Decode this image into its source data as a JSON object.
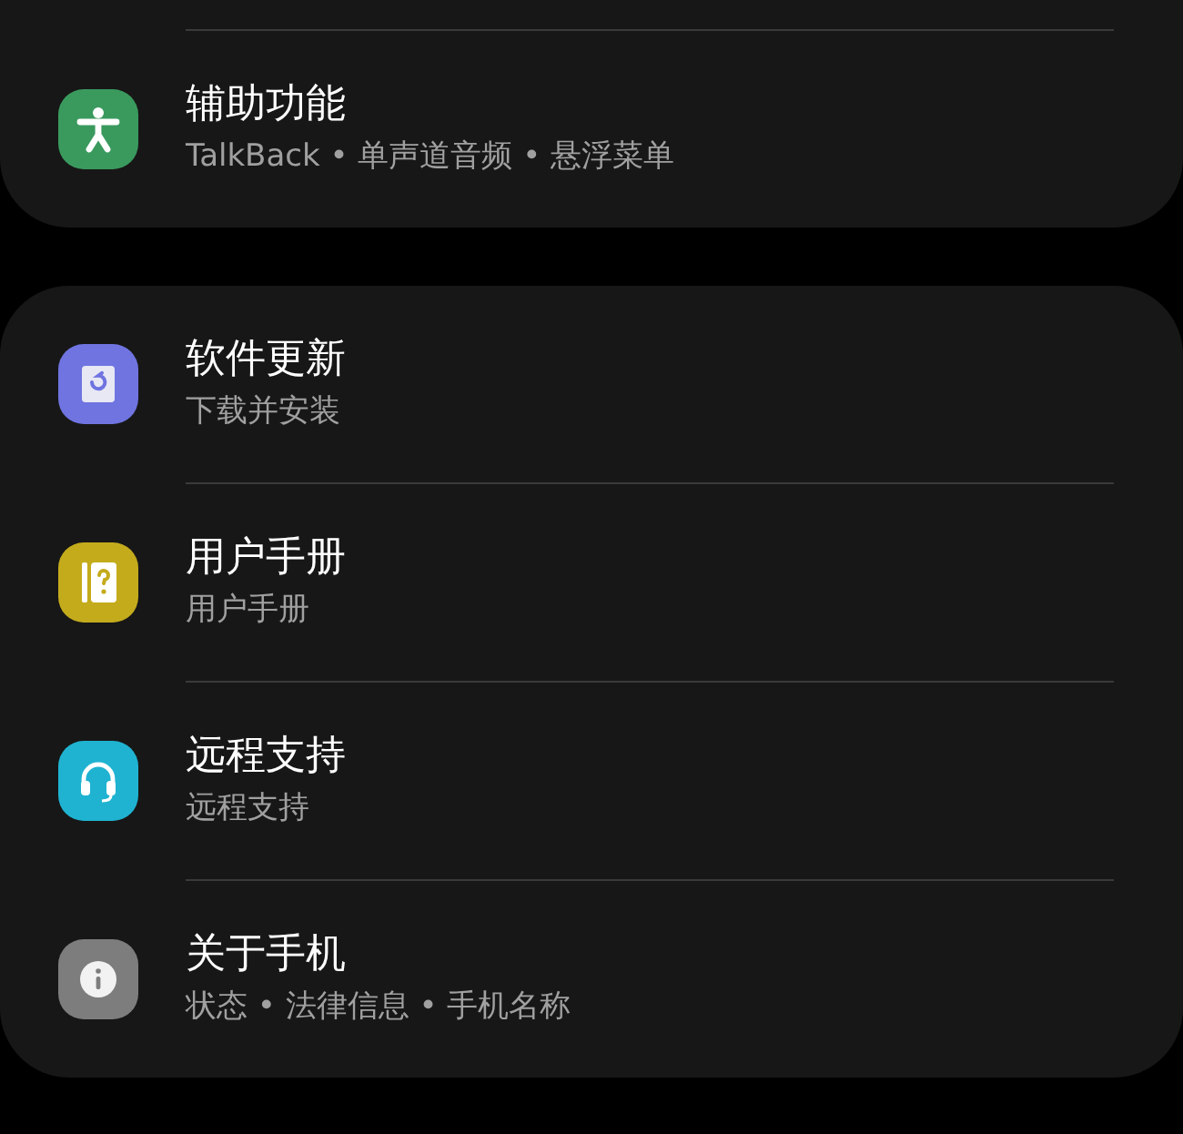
{
  "groups": [
    {
      "cut_top": true,
      "items": [
        {
          "title": "辅助功能",
          "subtitle": "TalkBack • 单声道音频 • 悬浮菜单",
          "kind": "accessibility",
          "color": "#3a9a5e"
        }
      ]
    },
    {
      "cut_top": false,
      "items": [
        {
          "title": "软件更新",
          "subtitle": "下载并安装",
          "kind": "update",
          "color": "#6f74e0"
        },
        {
          "title": "用户手册",
          "subtitle": "用户手册",
          "kind": "manual",
          "color": "#c4ab1c"
        },
        {
          "title": "远程支持",
          "subtitle": "远程支持",
          "kind": "support",
          "color": "#1fb3d1"
        },
        {
          "title": "关于手机",
          "subtitle": "状态 • 法律信息 • 手机名称",
          "kind": "info",
          "color": "#7d7d7d"
        }
      ]
    }
  ]
}
